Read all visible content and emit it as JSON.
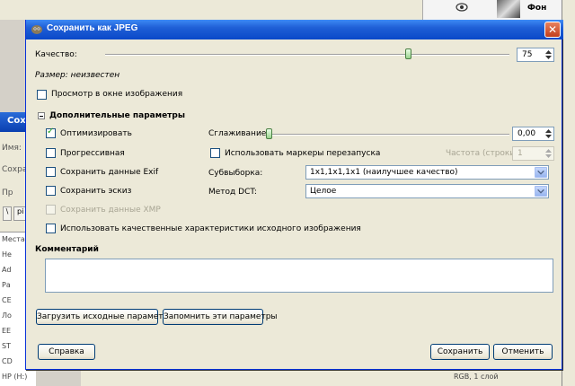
{
  "background": {
    "layers_panel": {
      "layer_name": "Фон"
    },
    "left_window": {
      "title": "Сох",
      "labels": [
        "Имя:",
        "Сохран",
        "Пр",
        "Места"
      ],
      "path_buttons": [
        "\\",
        "pi"
      ],
      "places": [
        "Не",
        "Ad",
        "Ра",
        "CE",
        "Ло",
        "ЕЕ",
        "ST",
        "CD",
        "HP (H:)"
      ]
    },
    "status_text": "RGB, 1 слой"
  },
  "dialog": {
    "title": "Сохранить как JPEG",
    "quality_label": "Качество:",
    "quality_value": "75",
    "quality_fraction": 0.75,
    "file_size_label": "Размер: неизвестен",
    "preview_label": "Просмотр в окне изображения",
    "advanced_header": "Дополнительные параметры",
    "options": {
      "optimize": "Оптимизировать",
      "progressive": "Прогрессивная",
      "save_exif": "Сохранить данные Exif",
      "save_thumbnail": "Сохранить эскиз",
      "save_xmp": "Сохранить данные XMP",
      "use_quality_of_original": "Использовать качественные характеристики исходного изображения"
    },
    "smoothing_label": "Сглаживание:",
    "smoothing_value": "0,00",
    "restart_markers_label": "Использовать маркеры перезапуска",
    "restart_frequency_label": "Частота (строки):",
    "restart_frequency_value": "1",
    "subsampling_label": "Субвыборка:",
    "subsampling_value": "1x1,1x1,1x1 (наилучшее качество)",
    "dct_label": "Метод DCT:",
    "dct_value": "Целое",
    "comment_label": "Комментарий",
    "load_defaults_button": "Загрузить исходные параметры",
    "save_defaults_button": "Запомнить эти параметры",
    "help_button": "Справка",
    "save_button": "Сохранить",
    "cancel_button": "Отменить"
  }
}
